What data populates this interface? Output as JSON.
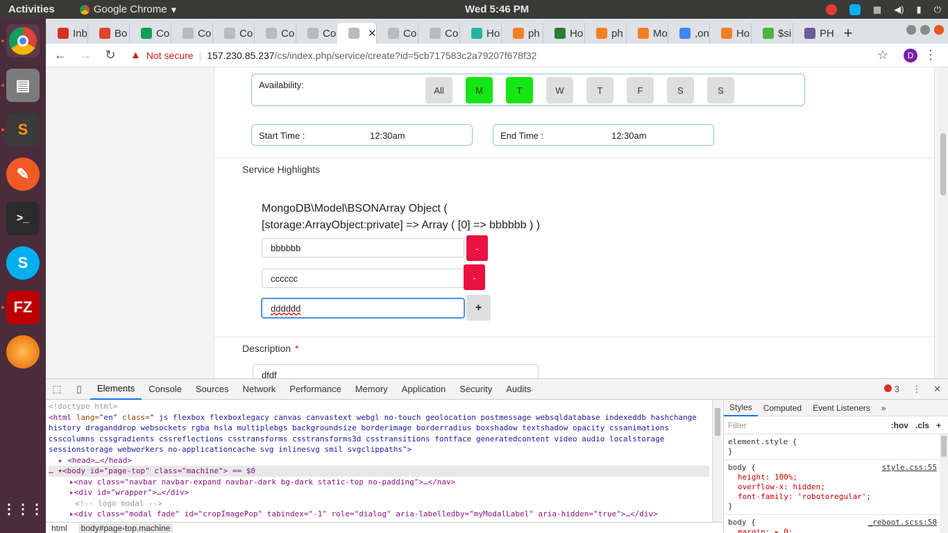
{
  "topbar": {
    "activities": "Activities",
    "app_name": "Google Chrome",
    "clock": "Wed  5:46 PM"
  },
  "tabs": [
    {
      "label": "Inb",
      "color": "#d93025"
    },
    {
      "label": "Bo",
      "color": "#e2432a"
    },
    {
      "label": "Co",
      "color": "#0f9d58"
    },
    {
      "label": "Co",
      "color": "#bbbbbb"
    },
    {
      "label": "Co",
      "color": "#bbbbbb"
    },
    {
      "label": "Co",
      "color": "#bbbbbb"
    },
    {
      "label": "Co",
      "color": "#bbbbbb"
    },
    {
      "label": "",
      "color": "#bbbbbb"
    },
    {
      "label": "Co",
      "color": "#bbbbbb"
    },
    {
      "label": "Co",
      "color": "#bbbbbb"
    },
    {
      "label": "Ho",
      "color": "#1fb6a0"
    },
    {
      "label": "ph",
      "color": "#f48024"
    },
    {
      "label": "Ho",
      "color": "#2d7a3a"
    },
    {
      "label": "ph",
      "color": "#f48024"
    },
    {
      "label": "Mo",
      "color": "#f48024"
    },
    {
      "label": ",on",
      "color": "#4285f4"
    },
    {
      "label": "Ho",
      "color": "#f48024"
    },
    {
      "label": "$si",
      "color": "#4db33d"
    },
    {
      "label": "PH",
      "color": "#6b5b95"
    }
  ],
  "address": {
    "security": "Not secure",
    "host": "157.230.85.237",
    "path": "/cs/index.php/service/create?id=5cb717583c2a79207f678f32",
    "profile_initial": "D"
  },
  "form": {
    "availability_label": "Availability:",
    "days": [
      {
        "label": "All",
        "selected": false
      },
      {
        "label": "M",
        "selected": true
      },
      {
        "label": "T",
        "selected": true
      },
      {
        "label": "W",
        "selected": false
      },
      {
        "label": "T",
        "selected": false
      },
      {
        "label": "F",
        "selected": false
      },
      {
        "label": "S",
        "selected": false
      },
      {
        "label": "S",
        "selected": false
      }
    ],
    "start_time_label": "Start Time :",
    "start_time_value": "12:30am",
    "end_time_label": "End Time :",
    "end_time_value": "12:30am",
    "highlights_title": "Service Highlights",
    "bson_line1": "MongoDB\\Model\\BSONArray Object (",
    "bson_line2": "[storage:ArrayObject:private] => Array ( [0] => bbbbbb ) )",
    "highlights": [
      "bbbbbb",
      "cccccc",
      "dddddd"
    ],
    "remove_label": "-",
    "add_label": "+",
    "description_title": "Description",
    "required_mark": "*",
    "description_value": "dfdf"
  },
  "devtools": {
    "tabs": [
      "Elements",
      "Console",
      "Sources",
      "Network",
      "Performance",
      "Memory",
      "Application",
      "Security",
      "Audits"
    ],
    "error_count": "3",
    "dom": {
      "doctype": "<!doctype html>",
      "html_open": "<html",
      "html_lang_attr": " lang=",
      "html_lang_val": "\"en\"",
      "html_class_attr": " class=",
      "html_class_val": "\" js flexbox flexboxlegacy canvas canvastext webgl no-touch geolocation postmessage websqldatabase indexeddb hashchange history draganddrop websockets rgba hsla multiplebgs backgroundsize borderimage borderradius boxshadow textshadow opacity cssanimations csscolumns cssgradients cssreflections csstransforms csstransforms3d csstransitions fontface generatedcontent video audio localstorage sessionstorage webworkers no-applicationcache svg inlinesvg smil svgclippaths\">",
      "head": "<head>…</head>",
      "body": "<body id=\"page-top\" class=\"machine\"> == $0",
      "nav": "<nav class=\"navbar navbar-expand navbar-dark bg-dark static-top no-padding\">…</nav>",
      "wrapper": "<div id=\"wrapper\">…</div>",
      "comment": "<!-- logo modal -->",
      "modal": "<div class=\"modal fade\" id=\"cropImagePop\" tabindex=\"-1\" role=\"dialog\" aria-labelledby=\"myModalLabel\" aria-hidden=\"true\">…</div>"
    },
    "breadcrumbs": [
      "html",
      "body#page-top.machine"
    ],
    "styles_tabs": [
      "Styles",
      "Computed",
      "Event Listeners"
    ],
    "filter_placeholder": "Filter",
    "hov": ":hov",
    "cls": ".cls",
    "rules": {
      "element_style": "element.style {",
      "close": "}",
      "body1_sel": "body {",
      "body1_src": "style.css:55",
      "body1_p1": "height: 100%;",
      "body1_p2": "overflow-x: hidden;",
      "body1_p3": "font-family: 'robotoregular';",
      "body2_sel": "body {",
      "body2_src": "_reboot.scss:58",
      "body2_p1": "margin: ▸ 0;"
    }
  }
}
